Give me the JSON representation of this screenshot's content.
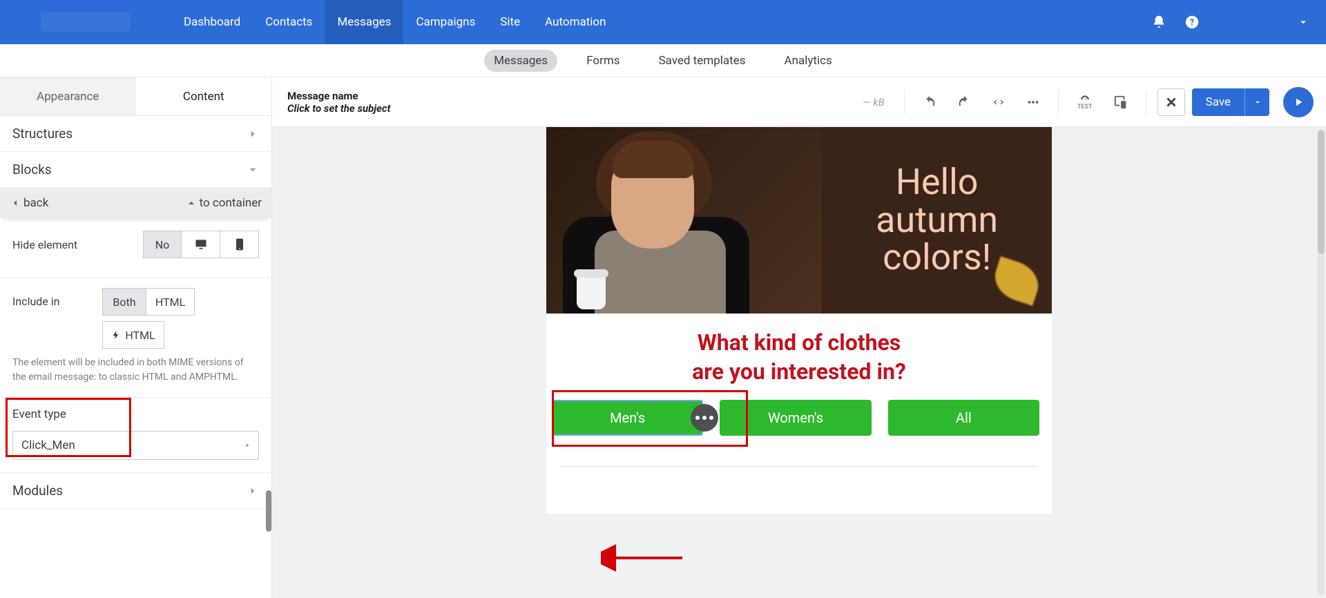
{
  "topnav": {
    "items": [
      "Dashboard",
      "Contacts",
      "Messages",
      "Campaigns",
      "Site",
      "Automation"
    ],
    "active_index": 2
  },
  "subnav": {
    "items": [
      "Messages",
      "Forms",
      "Saved templates",
      "Analytics"
    ],
    "active_index": 0
  },
  "sidebar": {
    "tabs": {
      "appearance": "Appearance",
      "content": "Content",
      "active": "content"
    },
    "sections": {
      "structures": "Structures",
      "blocks": "Blocks",
      "modules": "Modules"
    },
    "backrow": {
      "back": "back",
      "to_container": "to container"
    },
    "hide_element": {
      "label": "Hide element",
      "no": "No"
    },
    "include_in": {
      "label": "Include in",
      "options": [
        "Both",
        "HTML",
        "HTML"
      ],
      "amp_prefix_icon": "lightning-icon",
      "active_index": 0,
      "description": "The element will be included in both MIME versions of the email message: to classic HTML and AMPHTML."
    },
    "event_type": {
      "label": "Event type",
      "value": "Click_Men"
    }
  },
  "toolbar": {
    "message_name_label": "Message name",
    "subject_placeholder": "Click to set the subject",
    "size": "— kB",
    "save_label": "Save",
    "test_label": "TEST"
  },
  "email": {
    "hero_lines": [
      "Hello",
      "autumn",
      "colors!"
    ],
    "question_line1": "What kind of clothes",
    "question_line2": "are you interested in?",
    "buttons": [
      "Men's",
      "Women's",
      "All"
    ],
    "selected_button_index": 0
  },
  "colors": {
    "brand_blue": "#2c6cd6",
    "cta_green": "#2eb82e",
    "heading_red": "#c1121f",
    "annotation_red": "#d40000"
  }
}
